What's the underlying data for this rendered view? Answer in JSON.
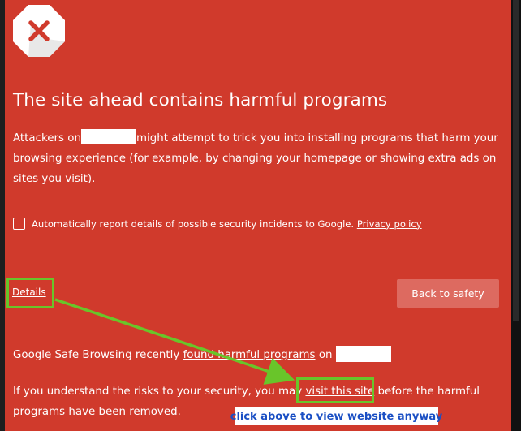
{
  "title": "The site ahead contains harmful programs",
  "intro": {
    "before": "Attackers on",
    "after": "might attempt to trick you into installing programs that harm your browsing experience (for example, by changing your homepage or showing extra ads on sites you visit)."
  },
  "report": {
    "label": "Automatically report details of possible security incidents to Google.",
    "privacy_link": "Privacy policy",
    "checked": false
  },
  "details_link": "Details",
  "back_button": "Back to safety",
  "gsb": {
    "before": "Google Safe Browsing recently",
    "link": "found harmful programs",
    "after": "on"
  },
  "understand": {
    "before": "If you understand the risks to your security, you may",
    "link": "visit this site",
    "after": "before the harmful programs have been removed."
  },
  "annotation": {
    "caption": "click above to view website anyway",
    "highlight_color": "#69c52a",
    "caption_color": "#1a4fc4"
  },
  "colors": {
    "background": "#d03a2c",
    "button": "#dd6a60"
  },
  "icons": {
    "warning": "stop-x-icon"
  }
}
